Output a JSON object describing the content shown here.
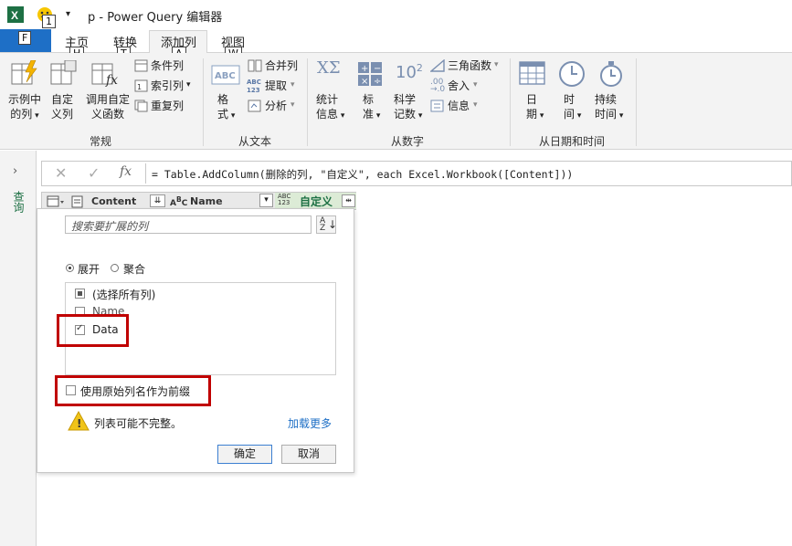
{
  "window": {
    "title": "p - Power Query 编辑器"
  },
  "tabs": [
    {
      "label": "主页"
    },
    {
      "label": "转换"
    },
    {
      "label": "添加列"
    },
    {
      "label": "视图"
    }
  ],
  "keytips": {
    "quick": "1",
    "file": "F",
    "home": "H",
    "transform": "T",
    "addcol": "A",
    "view": "W"
  },
  "ribbon": {
    "general": {
      "group_label": "常规",
      "example_col": [
        "示例中",
        "的列"
      ],
      "custom_col": [
        "自定",
        "义列"
      ],
      "invoke_fn": [
        "调用自定",
        "义函数"
      ],
      "conditional": "条件列",
      "index": "索引列",
      "duplicate": "重复列"
    },
    "text": {
      "group_label": "从文本",
      "format": [
        "格",
        "式"
      ],
      "merge": "合并列",
      "extract": "提取",
      "parse": "分析"
    },
    "number": {
      "group_label": "从数字",
      "stats": [
        "统计",
        "信息"
      ],
      "standard": [
        "标",
        "准"
      ],
      "scientific": [
        "科学",
        "记数"
      ],
      "trig": "三角函数",
      "rounding": "舍入",
      "info": "信息"
    },
    "datetime": {
      "group_label": "从日期和时间",
      "date": [
        "日",
        "期"
      ],
      "time": [
        "时",
        "间"
      ],
      "duration": [
        "持续",
        "时间"
      ]
    }
  },
  "left_panel": {
    "label": "查询"
  },
  "formula_bar": {
    "formula": "= Table.AddColumn(删除的列, \"自定义\", each Excel.Workbook([Content]))"
  },
  "column_headers": [
    {
      "type_icon": "binary",
      "name": "Content"
    },
    {
      "type_icon": "ABC",
      "name": "Name"
    },
    {
      "type_icon": "ABC123",
      "name": "自定义"
    }
  ],
  "expand_dialog": {
    "search_placeholder": "搜索要扩展的列",
    "mode_expand": "展开",
    "mode_aggregate": "聚合",
    "items": [
      {
        "label": "(选择所有列)",
        "state": "partial"
      },
      {
        "label": "Name",
        "state": "unchecked"
      },
      {
        "label": "Data",
        "state": "checked"
      }
    ],
    "prefix_label": "使用原始列名作为前缀",
    "warning": "列表可能不完整。",
    "load_more": "加载更多",
    "ok": "确定",
    "cancel": "取消"
  },
  "colors": {
    "accent": "#1e6fc6",
    "highlight": "#c00000",
    "link": "#1e6fc6"
  }
}
